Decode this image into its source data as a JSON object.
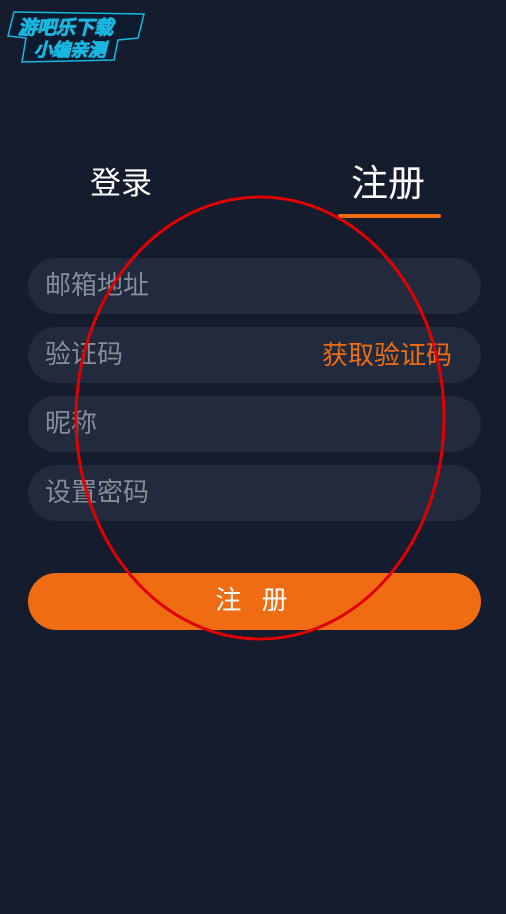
{
  "watermark": {
    "line1": "游吧乐下载",
    "line2": "小编亲测"
  },
  "tabs": {
    "login": "登录",
    "register": "注册",
    "active": "register"
  },
  "form": {
    "email_placeholder": "邮箱地址",
    "email_value": "",
    "code_placeholder": "验证码",
    "code_value": "",
    "get_code_label": "获取验证码",
    "nickname_placeholder": "昵称",
    "nickname_value": "",
    "password_placeholder": "设置密码",
    "password_value": "",
    "submit_label": "注 册"
  },
  "colors": {
    "background": "#141c2e",
    "field": "#222b3d",
    "accent": "#ee6c10",
    "annotation": "#e00000"
  }
}
